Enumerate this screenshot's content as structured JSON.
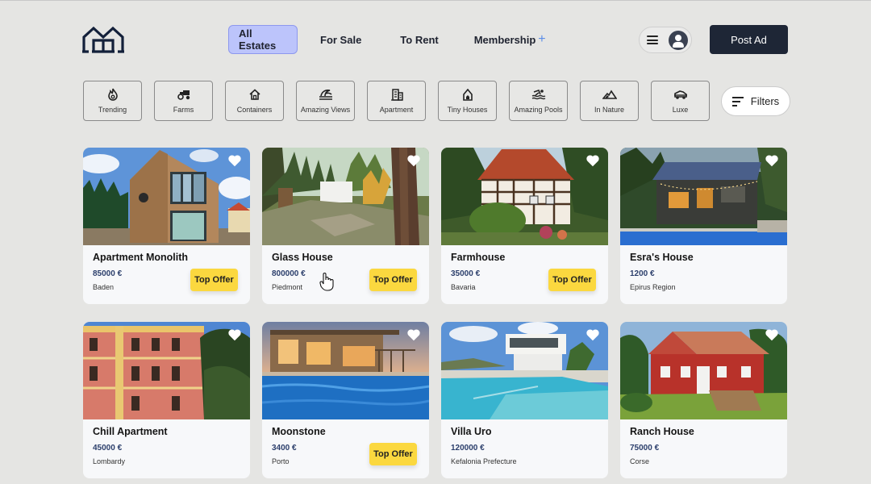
{
  "nav": {
    "logo": "house-logo",
    "items": [
      {
        "label": "All Estates",
        "active": true
      },
      {
        "label": "For Sale",
        "active": false
      },
      {
        "label": "To Rent",
        "active": false
      },
      {
        "label": "Membership",
        "active": false,
        "suffix": "+"
      }
    ],
    "post_ad": "Post Ad",
    "accent": "#bcc4fb"
  },
  "categories": [
    {
      "label": "Trending",
      "icon": "fire-icon"
    },
    {
      "label": "Farms",
      "icon": "tractor-icon"
    },
    {
      "label": "Containers",
      "icon": "home-icon"
    },
    {
      "label": "Amazing Views",
      "icon": "wave-view-icon"
    },
    {
      "label": "Apartment",
      "icon": "building-icon"
    },
    {
      "label": "Tiny Houses",
      "icon": "tiny-house-icon"
    },
    {
      "label": "Amazing Pools",
      "icon": "swimmer-icon"
    },
    {
      "label": "In Nature",
      "icon": "mountain-icon"
    },
    {
      "label": "Luxe",
      "icon": "luxury-car-icon"
    }
  ],
  "filters_label": "Filters",
  "listings": [
    {
      "title": "Apartment Monolith",
      "price": "85000 €",
      "location": "Baden",
      "badge": "Top Offer",
      "image": "wooden-modern-house"
    },
    {
      "title": "Glass House",
      "price": "800000 €",
      "location": "Piedmont",
      "badge": "Top Offer",
      "image": "glass-house-forest"
    },
    {
      "title": "Farmhouse",
      "price": "35000 €",
      "location": "Bavaria",
      "badge": "Top Offer",
      "image": "timber-frame-farmhouse"
    },
    {
      "title": "Esra's House",
      "price": "1200 €",
      "location": "Epirus Region",
      "badge": null,
      "image": "cabin-with-pool"
    },
    {
      "title": "Chill Apartment",
      "price": "45000 €",
      "location": "Lombardy",
      "badge": null,
      "image": "red-villa"
    },
    {
      "title": "Moonstone",
      "price": "3400 €",
      "location": "Porto",
      "badge": "Top Offer",
      "image": "stone-villa-pool"
    },
    {
      "title": "Villa Uro",
      "price": "120000 €",
      "location": "Kefalonia Prefecture",
      "badge": null,
      "image": "white-villa-pool"
    },
    {
      "title": "Ranch House",
      "price": "75000 €",
      "location": "Corse",
      "badge": null,
      "image": "red-ranch-house"
    }
  ],
  "badge_color": "#fbd83f",
  "price_color": "#2b3e6b"
}
